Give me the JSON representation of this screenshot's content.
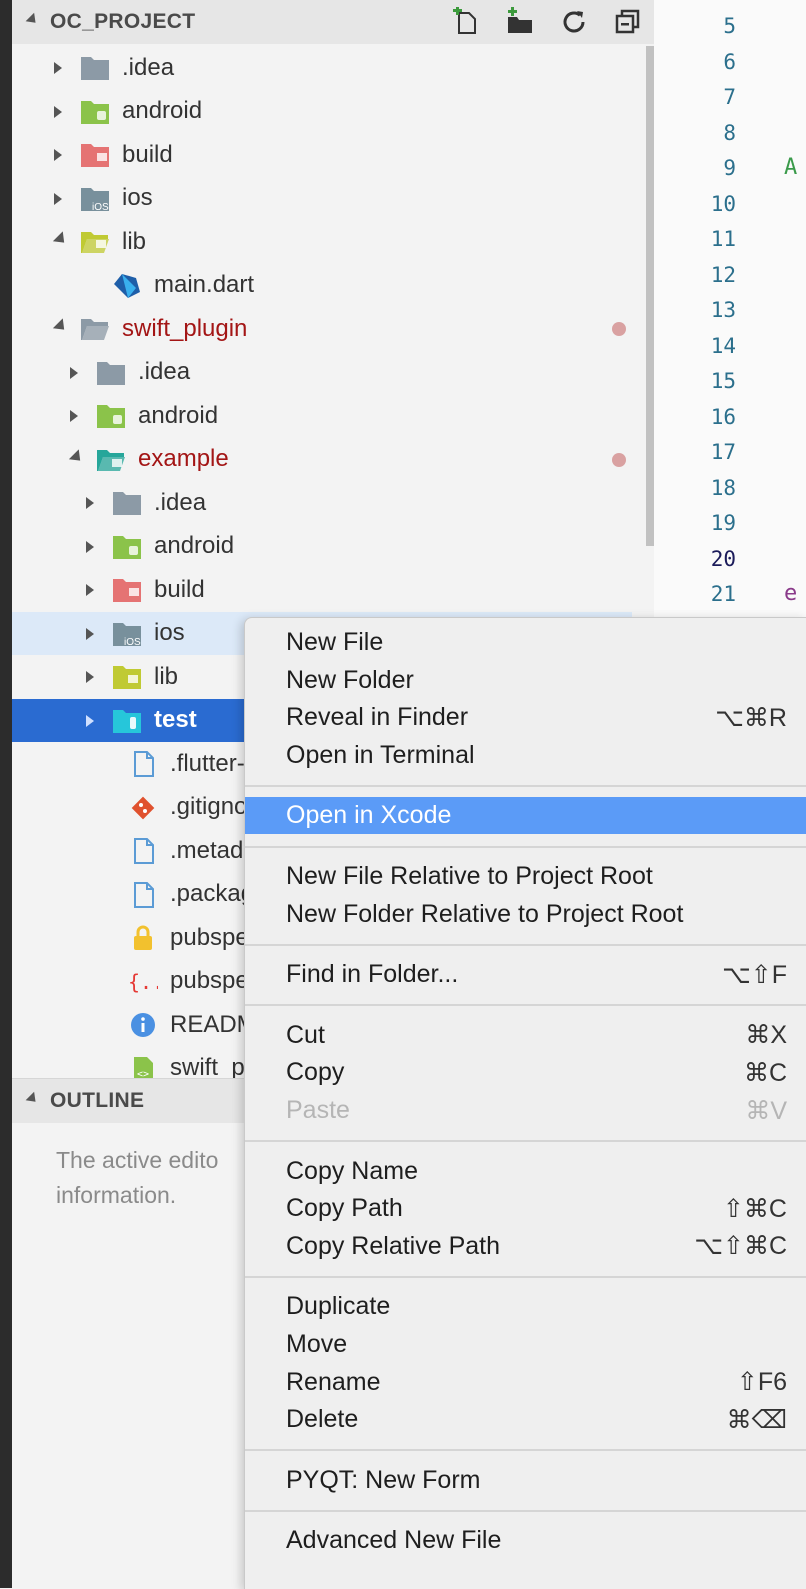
{
  "explorer": {
    "title": "OC_PROJECT",
    "actions": [
      "new-file-icon",
      "new-folder-icon",
      "refresh-icon",
      "collapse-all-icon"
    ],
    "items": [
      {
        "label": ".idea",
        "depth": 0,
        "state": "closed",
        "icon": "folder-icon",
        "color": "#8c9aa6"
      },
      {
        "label": "android",
        "depth": 0,
        "state": "closed",
        "icon": "android-folder-icon",
        "color": "#8bc34a"
      },
      {
        "label": "build",
        "depth": 0,
        "state": "closed",
        "icon": "build-folder-icon",
        "color": "#e57373"
      },
      {
        "label": "ios",
        "depth": 0,
        "state": "closed",
        "icon": "ios-folder-icon",
        "color": "#78909c"
      },
      {
        "label": "lib",
        "depth": 0,
        "state": "open",
        "icon": "lib-folder-icon",
        "color": "#c0ca33"
      },
      {
        "label": "main.dart",
        "depth": 1,
        "state": "none",
        "icon": "dart-file-icon",
        "color": "#1e5ea8"
      },
      {
        "label": "swift_plugin",
        "depth": 0,
        "state": "open",
        "icon": "folder-open-icon",
        "color": "#8c9aa6",
        "modified": true
      },
      {
        "label": ".idea",
        "depth": 1,
        "state": "closed",
        "icon": "folder-icon",
        "color": "#8c9aa6"
      },
      {
        "label": "android",
        "depth": 1,
        "state": "closed",
        "icon": "android-folder-icon",
        "color": "#8bc34a"
      },
      {
        "label": "example",
        "depth": 1,
        "state": "open",
        "icon": "example-folder-icon",
        "color": "#26a69a",
        "modified": true
      },
      {
        "label": ".idea",
        "depth": 2,
        "state": "closed",
        "icon": "folder-icon",
        "color": "#8c9aa6"
      },
      {
        "label": "android",
        "depth": 2,
        "state": "closed",
        "icon": "android-folder-icon",
        "color": "#8bc34a"
      },
      {
        "label": "build",
        "depth": 2,
        "state": "closed",
        "icon": "build-folder-icon",
        "color": "#e57373"
      },
      {
        "label": "ios",
        "depth": 2,
        "state": "closed",
        "icon": "ios-folder-icon",
        "color": "#78909c",
        "highlight": "light"
      },
      {
        "label": "lib",
        "depth": 2,
        "state": "closed",
        "icon": "lib-folder-icon",
        "color": "#c0ca33"
      },
      {
        "label": "test",
        "depth": 2,
        "state": "closed",
        "icon": "test-folder-icon",
        "color": "#26c6da",
        "highlight": "selected"
      },
      {
        "label": ".flutter-",
        "depth": 2,
        "state": "none",
        "icon": "file-icon",
        "color": "#5b9bd5"
      },
      {
        "label": ".gitigno",
        "depth": 2,
        "state": "none",
        "icon": "git-icon",
        "color": "#e0512e"
      },
      {
        "label": ".metada",
        "depth": 2,
        "state": "none",
        "icon": "file-icon",
        "color": "#5b9bd5"
      },
      {
        "label": ".packag",
        "depth": 2,
        "state": "none",
        "icon": "file-icon",
        "color": "#5b9bd5"
      },
      {
        "label": "pubspe",
        "depth": 2,
        "state": "none",
        "icon": "lock-icon",
        "color": "#f2c12e"
      },
      {
        "label": "pubspe",
        "depth": 2,
        "state": "none",
        "icon": "braces-icon",
        "color": "#e53935"
      },
      {
        "label": "READM",
        "depth": 2,
        "state": "none",
        "icon": "info-icon",
        "color": "#4a90e2"
      },
      {
        "label": "swift_pl",
        "depth": 2,
        "state": "none",
        "icon": "swift-file-icon",
        "color": "#8bc34a"
      }
    ]
  },
  "outline": {
    "title": "OUTLINE",
    "message_line1": "The active edito",
    "message_line2": "information."
  },
  "editor": {
    "line_numbers": [
      "5",
      "6",
      "7",
      "8",
      "9",
      "10",
      "11",
      "12",
      "13",
      "14",
      "15",
      "16",
      "17",
      "18",
      "19",
      "20",
      "21"
    ],
    "active_line": "20",
    "chars": [
      {
        "text": "A",
        "line": "9",
        "color": "#3a9a4a"
      },
      {
        "text": "e",
        "line": "21",
        "color": "#8a3a8a"
      }
    ]
  },
  "context_menu": {
    "groups": [
      [
        {
          "label": "New File",
          "shortcut": ""
        },
        {
          "label": "New Folder",
          "shortcut": ""
        },
        {
          "label": "Reveal in Finder",
          "shortcut": "⌥⌘R"
        },
        {
          "label": "Open in Terminal",
          "shortcut": ""
        }
      ],
      [
        {
          "label": "Open in Xcode",
          "shortcut": "",
          "highlighted": true
        }
      ],
      [
        {
          "label": "New File Relative to Project Root",
          "shortcut": ""
        },
        {
          "label": "New Folder Relative to Project Root",
          "shortcut": ""
        }
      ],
      [
        {
          "label": "Find in Folder...",
          "shortcut": "⌥⇧F"
        }
      ],
      [
        {
          "label": "Cut",
          "shortcut": "⌘X"
        },
        {
          "label": "Copy",
          "shortcut": "⌘C"
        },
        {
          "label": "Paste",
          "shortcut": "⌘V",
          "disabled": true
        }
      ],
      [
        {
          "label": "Copy Name",
          "shortcut": ""
        },
        {
          "label": "Copy Path",
          "shortcut": "⇧⌘C"
        },
        {
          "label": "Copy Relative Path",
          "shortcut": "⌥⇧⌘C"
        }
      ],
      [
        {
          "label": "Duplicate",
          "shortcut": ""
        },
        {
          "label": "Move",
          "shortcut": ""
        },
        {
          "label": "Rename",
          "shortcut": "⇧F6"
        },
        {
          "label": "Delete",
          "shortcut": "⌘⌫"
        }
      ],
      [
        {
          "label": "PYQT: New Form",
          "shortcut": ""
        }
      ],
      [
        {
          "label": "Advanced New File",
          "shortcut": ""
        }
      ]
    ]
  }
}
